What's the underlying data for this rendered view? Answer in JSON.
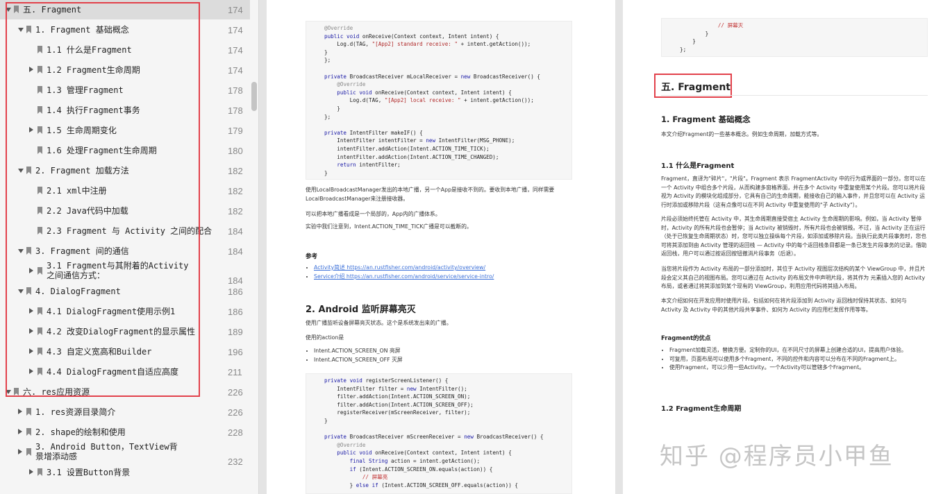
{
  "toc": [
    {
      "label": "五. Fragment",
      "page": "174",
      "level": 0,
      "arrow": "down",
      "selected": true
    },
    {
      "label": "1. Fragment 基础概念",
      "page": "174",
      "level": 1,
      "arrow": "down"
    },
    {
      "label": "1.1 什么是Fragment",
      "page": "174",
      "level": 2,
      "arrow": "none"
    },
    {
      "label": "1.2 Fragment生命周期",
      "page": "174",
      "level": 2,
      "arrow": "right"
    },
    {
      "label": "1.3 管理Fragment",
      "page": "178",
      "level": 2,
      "arrow": "none"
    },
    {
      "label": "1.4 执行Fragment事务",
      "page": "178",
      "level": 2,
      "arrow": "none"
    },
    {
      "label": "1.5 生命周期变化",
      "page": "179",
      "level": 2,
      "arrow": "right"
    },
    {
      "label": "1.6 处理Fragment生命周期",
      "page": "180",
      "level": 2,
      "arrow": "none"
    },
    {
      "label": "2. Fragment 加载方法",
      "page": "182",
      "level": 1,
      "arrow": "down"
    },
    {
      "label": "2.1 xml中注册",
      "page": "182",
      "level": 2,
      "arrow": "none"
    },
    {
      "label": "2.2 Java代码中加载",
      "page": "182",
      "level": 2,
      "arrow": "none"
    },
    {
      "label": "2.3 Fragment 与 Activity 之间的配合",
      "page": "184",
      "level": 2,
      "arrow": "none"
    },
    {
      "label": "3. Fragment 间的通信",
      "page": "184",
      "level": 1,
      "arrow": "down"
    },
    {
      "label": "3.1 Fragment与其附着的Activity之间通信方式：",
      "page": "184",
      "level": 2,
      "arrow": "right",
      "wrap": true
    },
    {
      "label": "4. DialogFragment",
      "page": "186",
      "level": 1,
      "arrow": "down"
    },
    {
      "label": "4.1 DialogFragment使用示例1",
      "page": "186",
      "level": 2,
      "arrow": "right"
    },
    {
      "label": "4.2 改变DialogFragment的显示属性",
      "page": "189",
      "level": 2,
      "arrow": "right"
    },
    {
      "label": "4.3 自定义宽高和Builder",
      "page": "196",
      "level": 2,
      "arrow": "right"
    },
    {
      "label": "4.4 DialogFragment自适应高度",
      "page": "211",
      "level": 2,
      "arrow": "right"
    },
    {
      "label": "六. res应用资源",
      "page": "226",
      "level": 0,
      "arrow": "down"
    },
    {
      "label": "1. res资源目录简介",
      "page": "226",
      "level": 1,
      "arrow": "right"
    },
    {
      "label": "2. shape的绘制和使用",
      "page": "228",
      "level": 1,
      "arrow": "right"
    },
    {
      "label": "3. Android Button，TextView背景增添动感",
      "page": "232",
      "level": 1,
      "arrow": "right",
      "wrap": true
    },
    {
      "label": "3.1 设置Button背景",
      "page": "",
      "level": 2,
      "arrow": "right"
    }
  ],
  "left_page": {
    "code1": [
      "@Override",
      "public void onReceive(Context context, Intent intent) {",
      "    Log.d(TAG, \"[App2] standard receive: \" + intent.getAction());",
      "}",
      "};",
      "",
      "private BroadcastReceiver mLocalReceiver = new BroadcastReceiver() {",
      "    @Override",
      "    public void onReceive(Context context, Intent intent) {",
      "        Log.d(TAG, \"[App2] local receive: \" + intent.getAction());",
      "    }",
      "};",
      "",
      "private IntentFilter makeIF() {",
      "    IntentFilter intentFilter = new IntentFilter(MSG_PHONE);",
      "    intentFilter.addAction(Intent.ACTION_TIME_TICK);",
      "    intentFilter.addAction(Intent.ACTION_TIME_CHANGED);",
      "    return intentFilter;",
      "}"
    ],
    "para1": "使用LocalBroadcastManager发出的本地广播，另一个App是接收不到的。要收到本地广播，同样需要LocalBroadcastManager来注册接收器。",
    "para2": "可以把本地广播看成是一个局部的，App内的广播体系。",
    "para3": "实验中我们注意到，Intent.ACTION_TIME_TICK广播是可以截断的。",
    "ref_title": "参考",
    "ref1": "Activity简述 https://an.rustfisher.com/android/activity/overview/",
    "ref2": "Service介绍 https://an.rustfisher.com/android/service/service-intro/",
    "h2_screen": "2. Android 监听屏幕亮灭",
    "para4": "使用广播监听设备屏幕亮灭状态。这个是系统发出来的广播。",
    "para5": "使用的action是",
    "bullet1": "Intent.ACTION_SCREEN_ON 亮屏",
    "bullet2": "Intent.ACTION_SCREEN_OFF 灭屏",
    "code2": [
      "private void registerScreenListener() {",
      "    IntentFilter filter = new IntentFilter();",
      "    filter.addAction(Intent.ACTION_SCREEN_ON);",
      "    filter.addAction(Intent.ACTION_SCREEN_OFF);",
      "    registerReceiver(mScreenReceiver, filter);",
      "}",
      "",
      "private BroadcastReceiver mScreenReceiver = new BroadcastReceiver() {",
      "    @Override",
      "    public void onReceive(Context context, Intent intent) {",
      "        final String action = intent.getAction();",
      "        if (Intent.ACTION_SCREEN_ON.equals(action)) {",
      "            // 屏幕亮",
      "        } else if (Intent.ACTION_SCREEN_OFF.equals(action)) {"
    ]
  },
  "right_page": {
    "code_top": [
      "            // 屏幕灭",
      "        }",
      "    }",
      "};"
    ],
    "title": "五. Fragment",
    "h2_basic": "1. Fragment 基础概念",
    "intro": "本文介绍Fragment的一些基本概念。例如生命周期，加载方式等。",
    "h3_what": "1.1 什么是Fragment",
    "p1": "Fragment，直译为\"碎片\"，\"片段\"。Fragment 表示 FragmentActivity 中的行为或界面的一部分。您可以在一个 Activity 中组合多个片段，从而构建多窗格界面，并在多个 Activity 中重复使用某个片段。您可以将片段视为 Activity 的模块化组成部分，它具有自己的生命周期，能接收自己的输入事件，并且您可以在 Activity 运行时添加或移除片段（这有点像可以在不同 Activity 中重复使用的\"子 Activity\"）。",
    "p2": "片段必须始终托管在 Activity 中，其生命周期直接受宿主 Activity 生命周期的影响。例如，当 Activity 暂停时，Activity 的所有片段也会暂停；当 Activity 被销毁时，所有片段也会被销毁。不过，当 Activity 正在运行（处于已恢复生命周期状态）时，您可以独立操纵每个片段，如添加或移除片段。当执行此类片段事务时，您也可将其添加到由 Activity 管理的返回栈 — Activity 中的每个返回栈条目都是一条已发生片段事务的记录。借助返回栈，用户可以通过按返回按钮撤消片段事务（后退）。",
    "p3": "当您将片段作为 Activity 布局的一部分添加时，其位于 Activity 视图层次结构的某个 ViewGroup 中，并且片段会定义其自己的视图布局。您可以通过在 Activity 的布局文件中声明片段，将其作为 元素插入您的 Activity 布局，或者通过将其添加到某个现有的 ViewGroup，利用应用代码将其插入布局。",
    "p4": "本文介绍如何在开发应用时使用片段，包括如何在将片段添加到 Activity 返回栈时保持其状态、如何与 Activity 及 Activity 中的其他片段共享事件、如何为 Activity 的应用栏发挥作用等等。",
    "h4_adv": "Fragment的优点",
    "adv1": "Fragment加载灵活，替换方便。定制你的UI，在不同尺寸的屏幕上创建合适的UI，提高用户体验。",
    "adv2": "可复用，页面布局可以使用多个Fragment，不同的控件和内容可以分布在不同的Fragment上。",
    "adv3": "使用Fragment，可以少用一些Activity。一个Activity可以管辖多个Fragment。",
    "h3_life": "1.2 Fragment生命周期"
  },
  "watermark": "知乎 @程序员小甲鱼",
  "colors": {
    "highlight_border": "#e2404a",
    "link": "#3a6fd8",
    "keyword": "#1a1aa6",
    "string": "#b02a2a"
  }
}
